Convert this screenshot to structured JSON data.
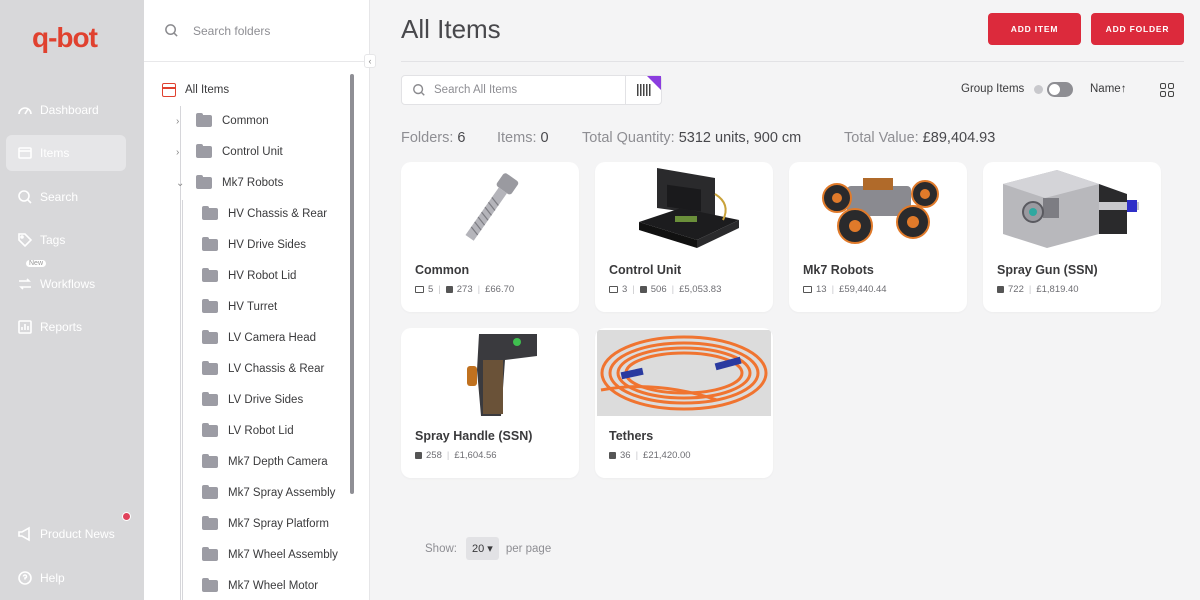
{
  "brand": {
    "logo_q": "q",
    "logo_rest": "-bot"
  },
  "nav": {
    "items": [
      {
        "label": "Dashboard"
      },
      {
        "label": "Items"
      },
      {
        "label": "Search"
      },
      {
        "label": "Tags"
      },
      {
        "label": "Workflows",
        "badge": "New"
      },
      {
        "label": "Reports"
      },
      {
        "label": "Product News"
      },
      {
        "label": "Help"
      }
    ]
  },
  "folders": {
    "search_placeholder": "Search folders",
    "root": "All Items",
    "top": [
      "Common",
      "Control Unit",
      "Mk7 Robots"
    ],
    "children": [
      "HV Chassis & Rear",
      "HV Drive Sides",
      "HV Robot Lid",
      "HV Turret",
      "LV Camera Head",
      "LV Chassis & Rear",
      "LV Drive Sides",
      "LV Robot Lid",
      "Mk7 Depth Camera",
      "Mk7 Spray Assembly",
      "Mk7 Spray Platform",
      "Mk7 Wheel Assembly",
      "Mk7 Wheel Motor"
    ]
  },
  "header": {
    "title": "All Items",
    "add_item": "ADD ITEM",
    "add_folder": "ADD FOLDER"
  },
  "toolbar": {
    "search_placeholder": "Search All Items",
    "group_label": "Group Items",
    "sort_label": "Name",
    "sort_arrow": "↑"
  },
  "stats": {
    "folders_label": "Folders:",
    "folders_value": "6",
    "items_label": "Items:",
    "items_value": "0",
    "qty_label": "Total Quantity:",
    "qty_value": "5312 units, 900 cm",
    "value_label": "Total Value:",
    "value_value": "£89,404.93"
  },
  "cards": [
    {
      "name": "Common",
      "folders": "5",
      "qty": "273",
      "value": "£66.70"
    },
    {
      "name": "Control Unit",
      "folders": "3",
      "qty": "506",
      "value": "£5,053.83"
    },
    {
      "name": "Mk7 Robots",
      "folders": "13",
      "value": "£59,440.44"
    },
    {
      "name": "Spray Gun (SSN)",
      "qty": "722",
      "value": "£1,819.40"
    },
    {
      "name": "Spray Handle (SSN)",
      "qty": "258",
      "value": "£1,604.56"
    },
    {
      "name": "Tethers",
      "qty": "36",
      "value": "£21,420.00"
    }
  ],
  "pager": {
    "show_label": "Show:",
    "per_page_value": "20",
    "per_page_label": "per page"
  },
  "colors": {
    "accent": "#dc2a3c",
    "logo": "#e0412f",
    "barcode_corner": "#8b3ddf"
  }
}
